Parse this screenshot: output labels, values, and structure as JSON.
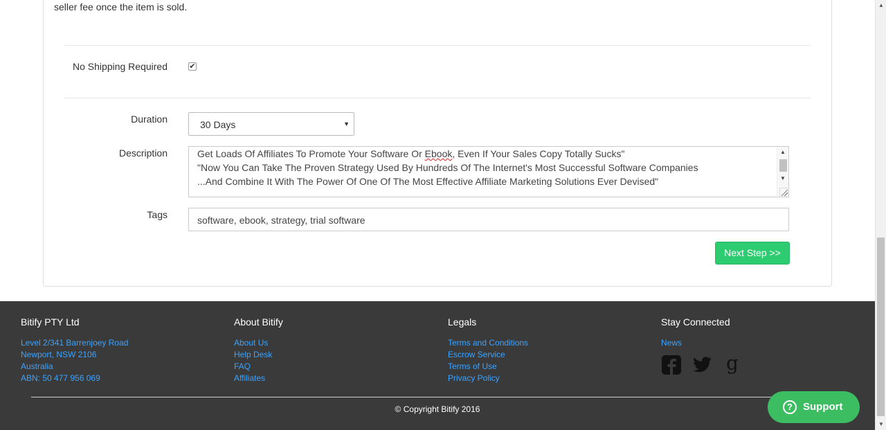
{
  "form": {
    "intro_text": "seller fee once the item is sold.",
    "no_shipping_label": "No Shipping Required",
    "no_shipping_checked": true,
    "duration_label": "Duration",
    "duration_value": "30 Days",
    "description_label": "Description",
    "description_lines": [
      "Get Loads Of Affiliates To Promote Your Software Or ",
      "Ebook",
      ", Even If Your Sales Copy Totally Sucks\"",
      "\"Now You Can Take The Proven Strategy Used By Hundreds Of The Internet's Most Successful Software Companies",
      "...And Combine It With The Power Of One Of The Most Effective Affiliate Marketing Solutions Ever Devised\""
    ],
    "tags_label": "Tags",
    "tags_value": "software, ebook, strategy, trial software",
    "next_button": "Next Step >>"
  },
  "footer": {
    "company": {
      "title": "Bitify PTY Ltd",
      "lines": [
        "Level 2/341 Barrenjoey Road",
        "Newport, NSW 2106",
        "Australia",
        "ABN: 50 477 956 069"
      ]
    },
    "about": {
      "title": "About Bitify",
      "links": [
        "About Us",
        "Help Desk",
        "FAQ",
        "Affiliates"
      ]
    },
    "legals": {
      "title": "Legals",
      "links": [
        "Terms and Conditions",
        "Escrow Service",
        "Terms of Use",
        "Privacy Policy"
      ]
    },
    "connected": {
      "title": "Stay Connected",
      "links": [
        "News"
      ],
      "social_icons": [
        "facebook-icon",
        "twitter-icon",
        "google-icon"
      ]
    },
    "copyright": "© Copyright Bitify 2016"
  },
  "support": {
    "label": "Support",
    "icon": "question-icon"
  },
  "colors": {
    "accent_green": "#2ecc71",
    "support_green": "#3cbd62",
    "footer_bg": "#3a3a3a",
    "link_blue": "#3aa3ff"
  }
}
